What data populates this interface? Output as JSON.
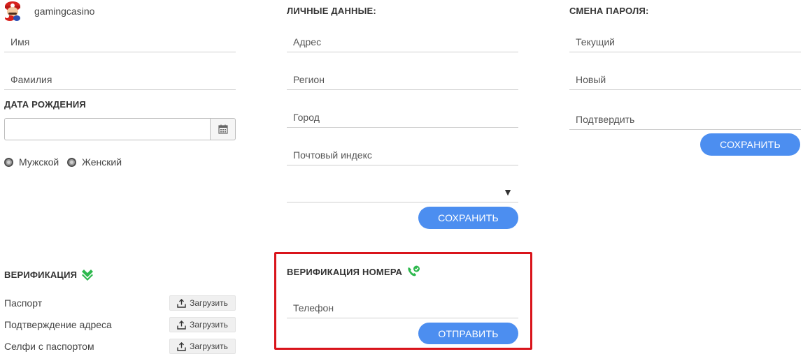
{
  "user": {
    "name": "gamingcasino",
    "avatar_icon": "mario-avatar"
  },
  "profile": {
    "first_name_placeholder": "Имя",
    "last_name_placeholder": "Фамилия",
    "birthdate_heading": "ДАТА РОЖДЕНИЯ",
    "birthdate_value": "",
    "gender_options": [
      "Мужской",
      "Женский"
    ]
  },
  "personal": {
    "heading": "ЛИЧНЫЕ ДАННЫЕ:",
    "address_placeholder": "Адрес",
    "region_placeholder": "Регион",
    "city_placeholder": "Город",
    "postal_placeholder": "Почтовый индекс",
    "country_selected": "",
    "save_label": "СОХРАНИТЬ"
  },
  "password": {
    "heading": "СМЕНА ПАРОЛЯ:",
    "current_placeholder": "Текущий",
    "new_placeholder": "Новый",
    "confirm_placeholder": "Подтвердить",
    "save_label": "СОХРАНИТЬ"
  },
  "verification": {
    "heading": "ВЕРИФИКАЦИЯ",
    "upload_label": "Загрузить",
    "documents": [
      "Паспорт",
      "Подтверждение адреса",
      "Селфи с паспортом"
    ]
  },
  "phone_verification": {
    "heading": "ВЕРИФИКАЦИЯ НОМЕРА",
    "phone_placeholder": "Телефон",
    "send_label": "ОТПРАВИТЬ",
    "highlight_color": "#d9141b"
  },
  "colors": {
    "accent": "#4c8ef0",
    "verified": "#2db84d"
  }
}
